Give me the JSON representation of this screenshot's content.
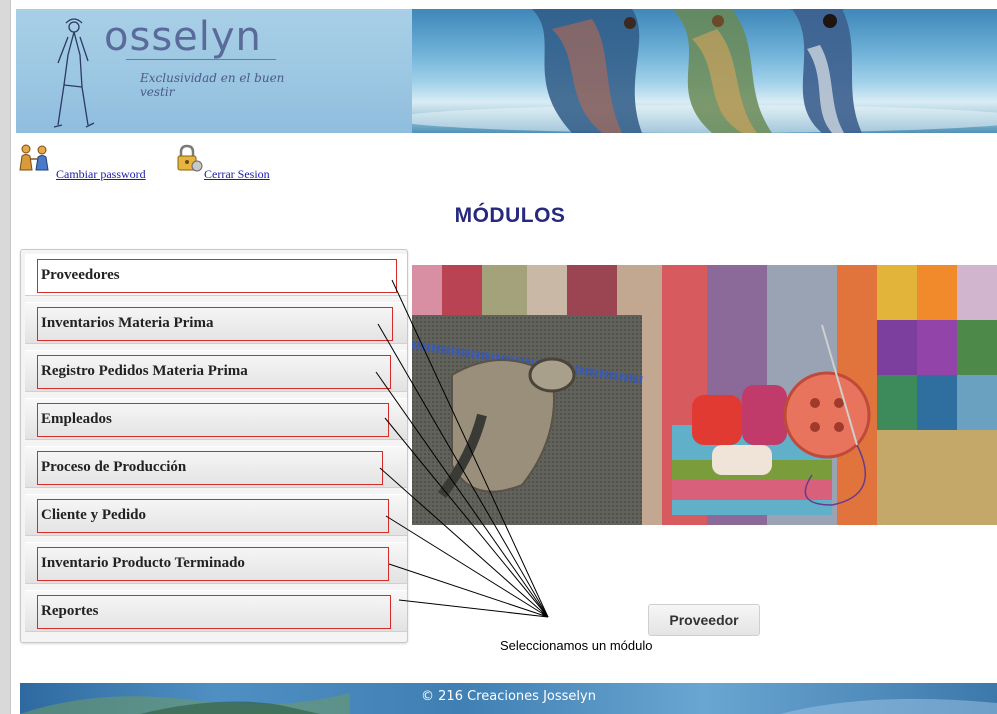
{
  "brand": {
    "name": "osselyn",
    "tagline": "Exclusividad en el buen vestir"
  },
  "toplinks": {
    "change_password": "Cambiar password",
    "logout": "Cerrar Sesion"
  },
  "title": "MÓDULOS",
  "modules": [
    {
      "label": "Proveedores",
      "active": true
    },
    {
      "label": "Inventarios Materia Prima",
      "active": false
    },
    {
      "label": "Registro Pedidos Materia Prima",
      "active": false
    },
    {
      "label": "Empleados",
      "active": false
    },
    {
      "label": "Proceso de Producción",
      "active": false
    },
    {
      "label": "Cliente y Pedido",
      "active": false
    },
    {
      "label": "Inventario Producto Terminado",
      "active": false
    },
    {
      "label": "Reportes",
      "active": false
    }
  ],
  "action_button": "Proveedor",
  "annotation": "Seleccionamos un módulo",
  "footer": "© 216 Creaciones Josselyn",
  "colors": {
    "title": "#27297f",
    "link": "#1a1aa6",
    "annotation_outline": "#d42b2b",
    "header_bg": "#9bc6e2"
  },
  "icons": [
    "users-icon",
    "lock-icon",
    "logo-figure"
  ]
}
